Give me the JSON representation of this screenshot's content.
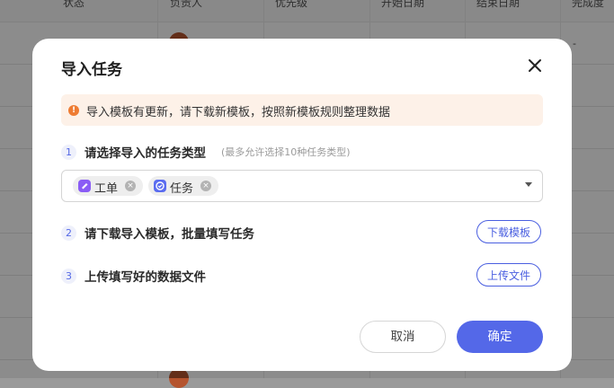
{
  "background_table": {
    "columns": [
      "状态",
      "负责人",
      "优先级",
      "开始日期",
      "结束日期",
      "完成度"
    ],
    "dash": "-"
  },
  "modal": {
    "title": "导入任务",
    "notice": "导入模板有更新，请下载新模板，按照新模板规则整理数据",
    "steps": [
      {
        "number": "1",
        "label": "请选择导入的任务类型",
        "hint": "(最多允许选择10种任务类型)"
      },
      {
        "number": "2",
        "label": "请下载导入模板，批量填写任务",
        "button": "下载模板"
      },
      {
        "number": "3",
        "label": "上传填写好的数据文件",
        "button": "上传文件"
      }
    ],
    "selected_types": [
      {
        "label": "工单",
        "icon": "ticket-icon",
        "color": "#8a5cf5"
      },
      {
        "label": "任务",
        "icon": "task-check-icon",
        "color": "#5a6cf0"
      }
    ],
    "cancel": "取消",
    "confirm": "确定"
  },
  "colors": {
    "primary": "#5468e8",
    "notice_bg": "#fdf1e8",
    "notice_icon": "#ee7c33"
  }
}
